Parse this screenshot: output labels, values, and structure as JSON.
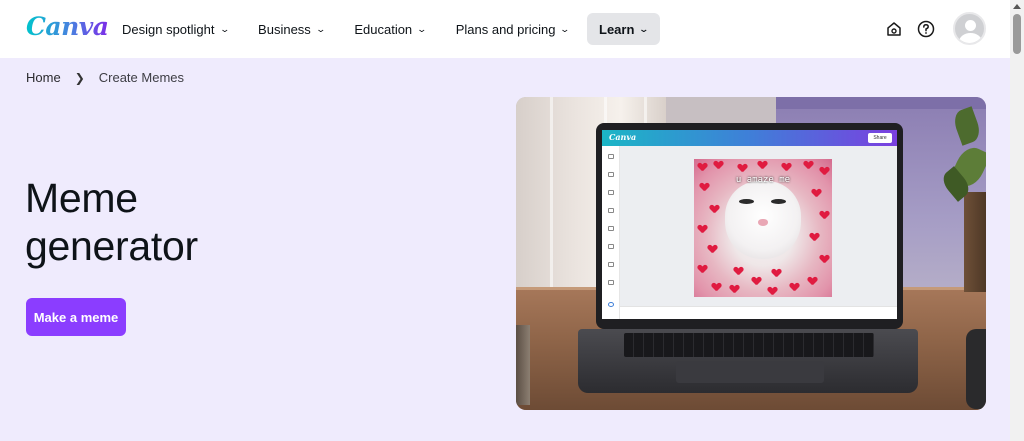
{
  "header": {
    "logo": "Canva",
    "nav": [
      {
        "label": "Design spotlight",
        "active": false
      },
      {
        "label": "Business",
        "active": false
      },
      {
        "label": "Education",
        "active": false
      },
      {
        "label": "Plans and pricing",
        "active": false
      },
      {
        "label": "Learn",
        "active": true
      }
    ],
    "icons": [
      "home-icon",
      "help-icon"
    ],
    "avatar_icon": "user-avatar-icon"
  },
  "breadcrumb": {
    "home": "Home",
    "separator_icon": "chevron-right-icon",
    "current": "Create Memes"
  },
  "hero": {
    "title_line1": "Meme",
    "title_line2": "generator",
    "cta_label": "Make a meme",
    "image": {
      "editor_logo": "Canva",
      "share_label": "Share",
      "meme_caption": "u amaze me"
    }
  },
  "colors": {
    "accent": "#8b3dff",
    "hero_bg": "#efebfd",
    "active_nav_bg": "#e4e5e8",
    "text": "#0e1318"
  }
}
